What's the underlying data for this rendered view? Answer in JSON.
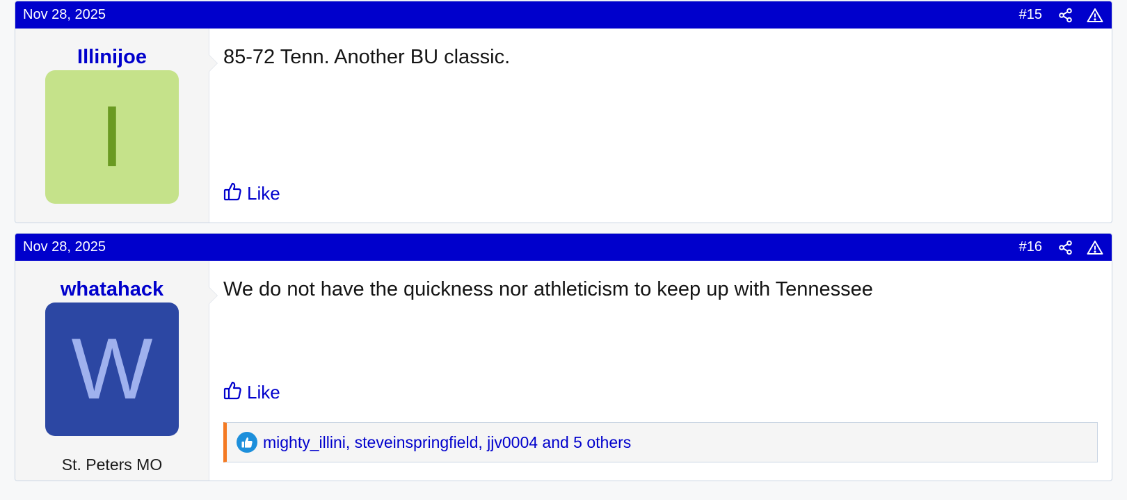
{
  "posts": [
    {
      "date": "Nov 28, 2025",
      "number": "#15",
      "username": "Illinijoe",
      "avatar_letter": "I",
      "avatar_bg": "#c5e28a",
      "avatar_fg": "#6a9a22",
      "message": "85-72 Tenn. Another BU classic.",
      "like_label": "Like"
    },
    {
      "date": "Nov 28, 2025",
      "number": "#16",
      "username": "whatahack",
      "avatar_letter": "W",
      "avatar_bg": "#2c47a3",
      "avatar_fg": "#9fb1ee",
      "location": "St. Peters MO",
      "message": "We do not have the quickness nor athleticism to keep up with Tennessee",
      "like_label": "Like",
      "reactions": "mighty_illini, steveinspringfield, jjv0004 and 5 others"
    }
  ],
  "icons": {
    "share": "share-icon",
    "report": "warning-icon",
    "like": "thumbs-up-icon",
    "reaction": "like-reaction-icon"
  },
  "colors": {
    "header": "#0000cc",
    "link": "#0000cc",
    "reaction_accent": "#f47a23"
  }
}
